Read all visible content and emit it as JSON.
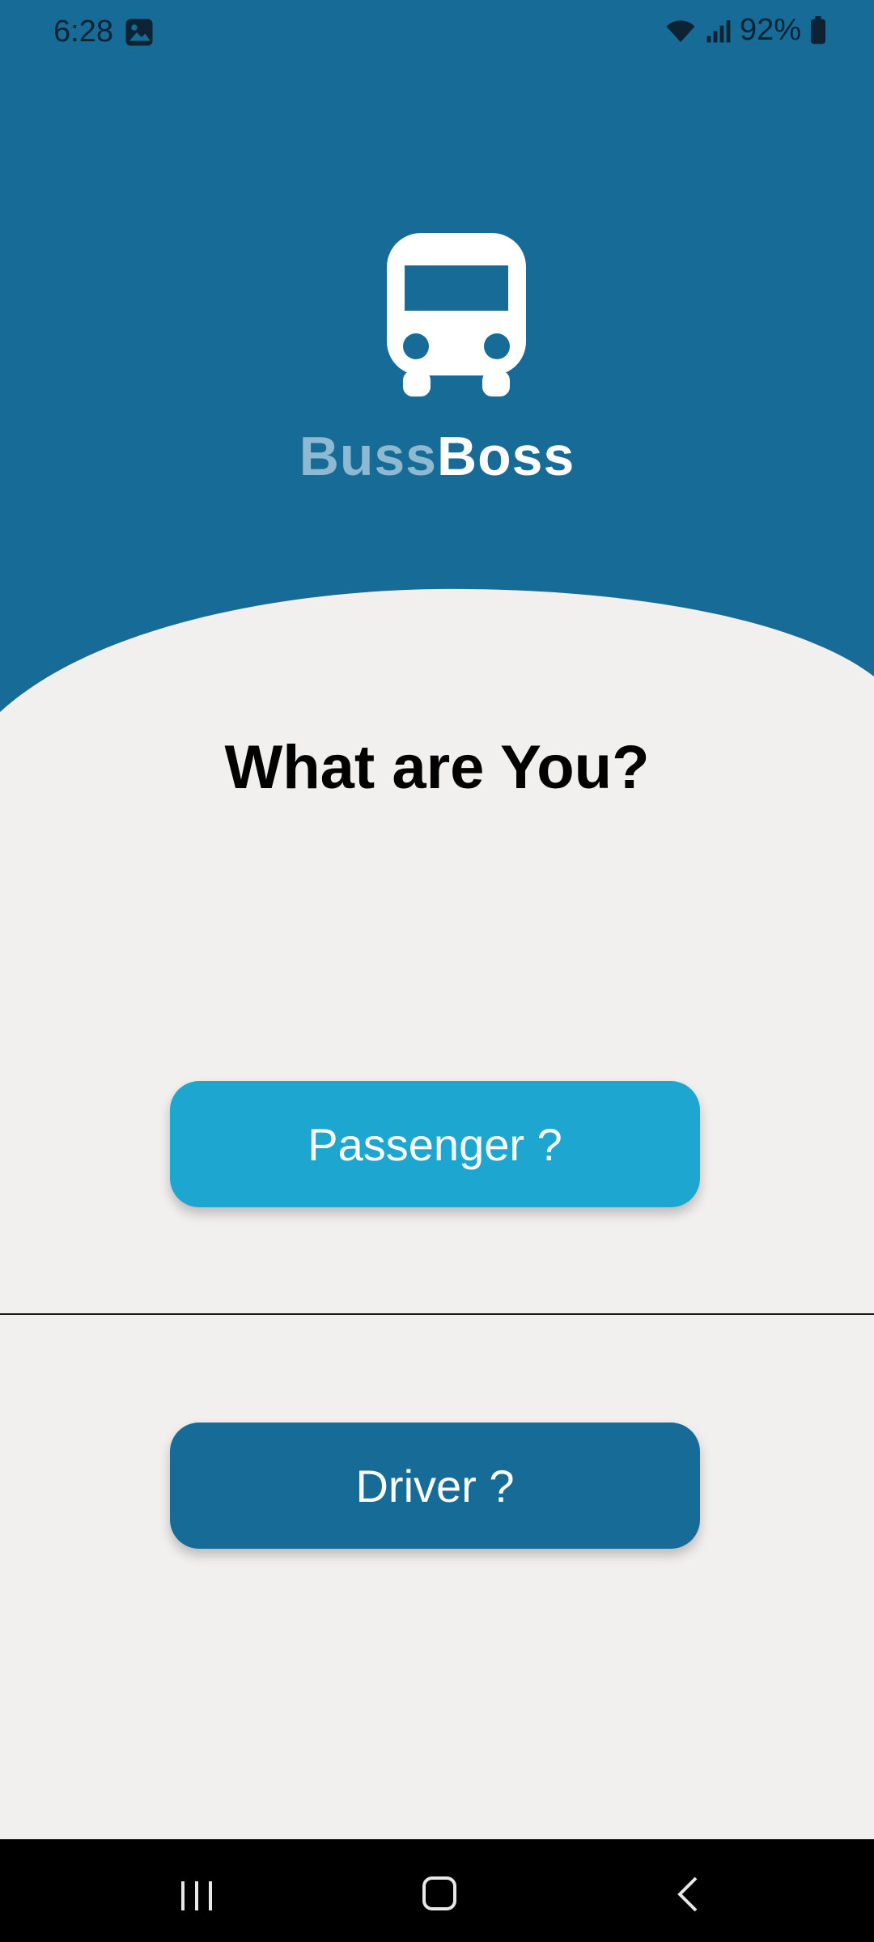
{
  "status_bar": {
    "time": "6:28",
    "battery": "92%",
    "icons": [
      "gallery-icon",
      "wifi-icon",
      "signal-icon",
      "battery-icon"
    ]
  },
  "app": {
    "brand_part1": "Buss",
    "brand_part2": "Boss",
    "logo_icon": "bus-icon"
  },
  "main": {
    "question": "What are You?",
    "passenger_label": "Passenger ?",
    "driver_label": "Driver ?"
  },
  "nav_bar": {
    "icons": [
      "recent-apps-icon",
      "home-icon",
      "back-icon"
    ]
  },
  "colors": {
    "primary": "#166c96",
    "accent": "#1da7d0",
    "background": "#f2efef",
    "brand_light": "#8fb9d1"
  }
}
